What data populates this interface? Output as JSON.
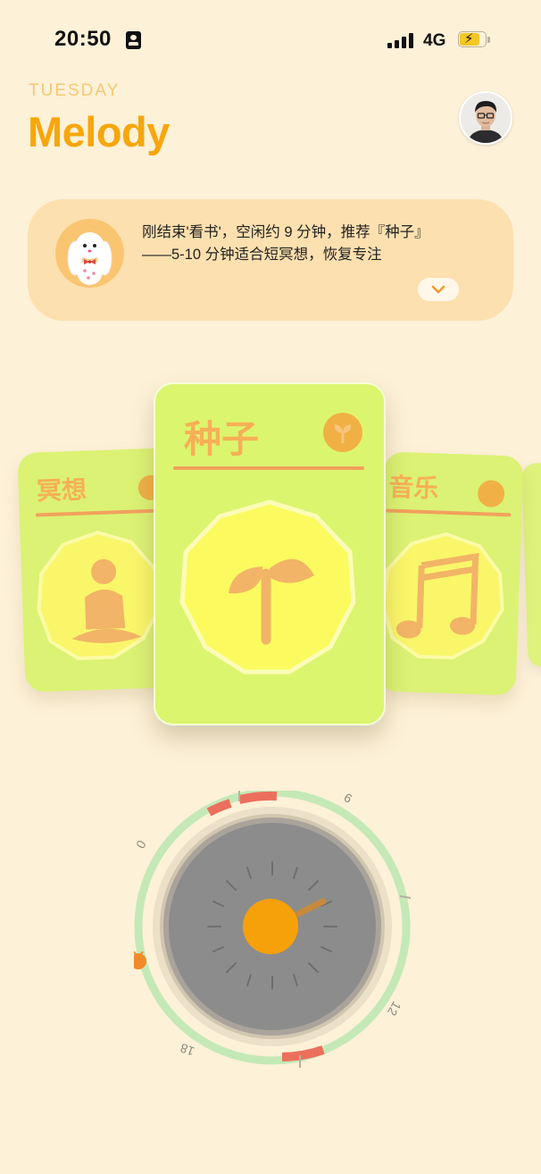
{
  "status_bar": {
    "time": "20:50",
    "network": "4G"
  },
  "header": {
    "day": "TUESDAY",
    "title": "Melody"
  },
  "recommendation": {
    "line1": "刚结束'看书'，空闲约 9 分钟，推荐『种子』",
    "line2": "——5-10 分钟适合短冥想，恢复专注"
  },
  "cards": {
    "left": {
      "label": "冥想",
      "icon": "meditation-icon"
    },
    "center": {
      "label": "种子",
      "icon": "sprout-icon"
    },
    "right": {
      "label": "音乐",
      "icon": "music-note-icon"
    }
  },
  "dial": {
    "ticks": {
      "t0": "0",
      "t6": "6",
      "t12": "12",
      "t18": "18"
    },
    "center_icon": "sun-icon"
  },
  "colors": {
    "background": "#fdf1d8",
    "accent": "#f7a60b",
    "card_green": "#dcf56f",
    "dial_ring": "#c4e9b6",
    "dial_busy": "#ec6f5d"
  }
}
